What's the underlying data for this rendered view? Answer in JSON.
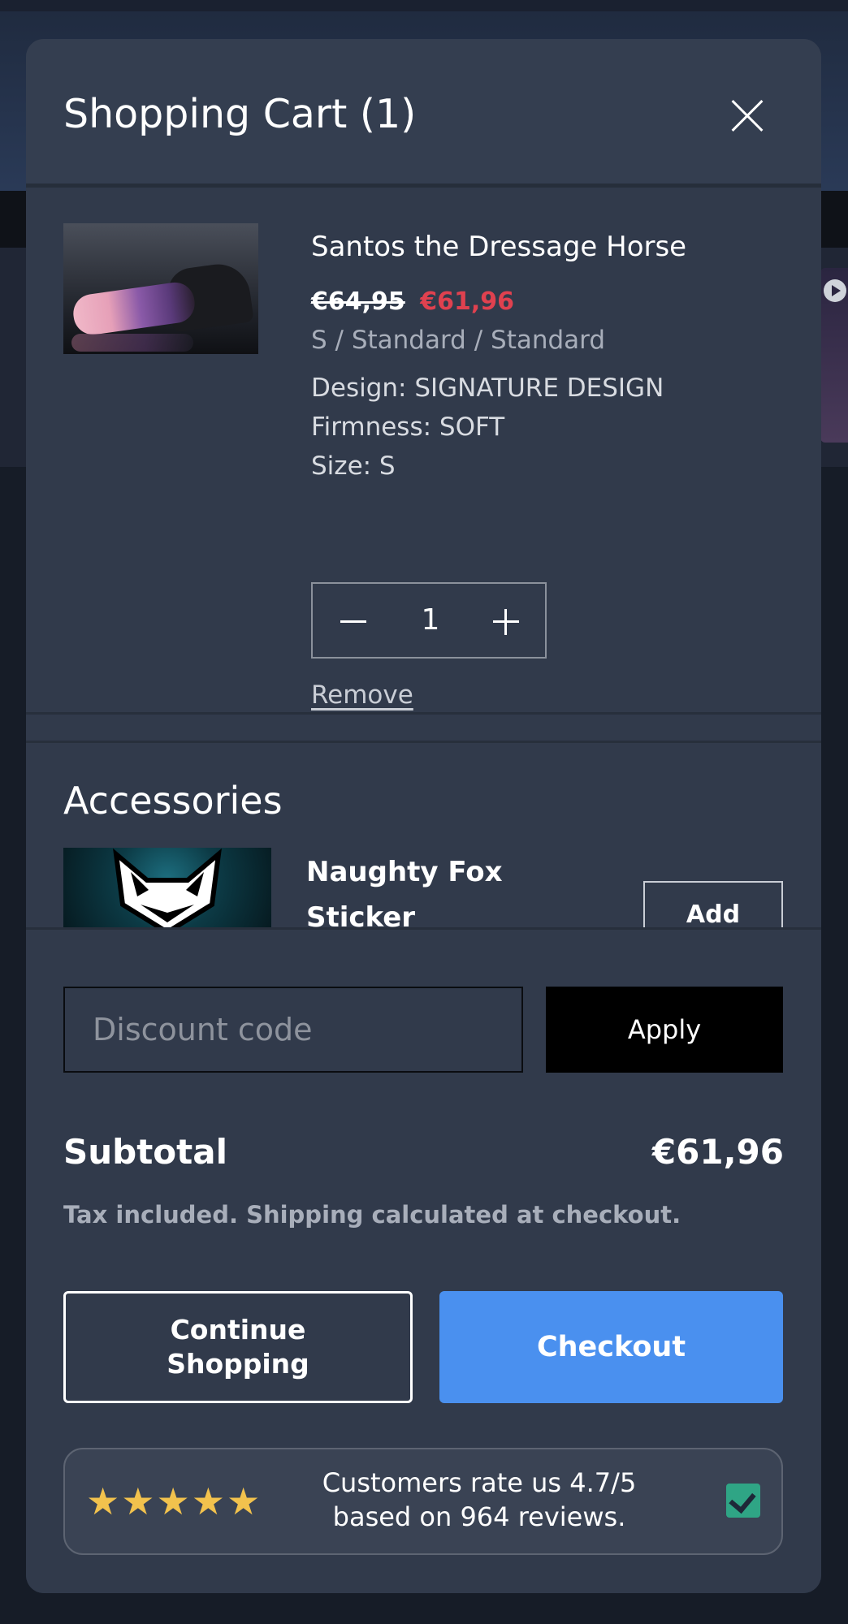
{
  "cart": {
    "title": "Shopping Cart (1)",
    "item": {
      "name": "Santos the Dressage Horse",
      "price_old": "€64,95",
      "price_new": "€61,96",
      "variant": "S / Standard / Standard",
      "options": {
        "design": "Design: SIGNATURE DESIGN",
        "firmness": "Firmness: SOFT",
        "size": "Size: S"
      },
      "quantity": "1",
      "remove_label": "Remove"
    },
    "accessories": {
      "title": "Accessories",
      "item_name": "Naughty Fox Sticker",
      "add_label": "Add"
    },
    "discount": {
      "placeholder": "Discount code",
      "apply_label": "Apply"
    },
    "subtotal": {
      "label": "Subtotal",
      "value": "€61,96",
      "note": "Tax included. Shipping calculated at checkout."
    },
    "buttons": {
      "continue": "Continue Shopping",
      "checkout": "Checkout"
    },
    "reviews": {
      "stars": "★★★★★",
      "rating": 5,
      "text": "Customers rate us 4.7/5 based on 964 reviews."
    }
  },
  "colors": {
    "modal_bg": "#313a4b",
    "sale_price": "#e0414f",
    "checkout_button": "#4a90ef",
    "apply_button": "#000000",
    "star": "#f2c24d",
    "verified_badge": "#2fa585"
  },
  "icons": [
    "close-icon",
    "minus-icon",
    "plus-icon",
    "star-icon",
    "verified-check-icon"
  ]
}
